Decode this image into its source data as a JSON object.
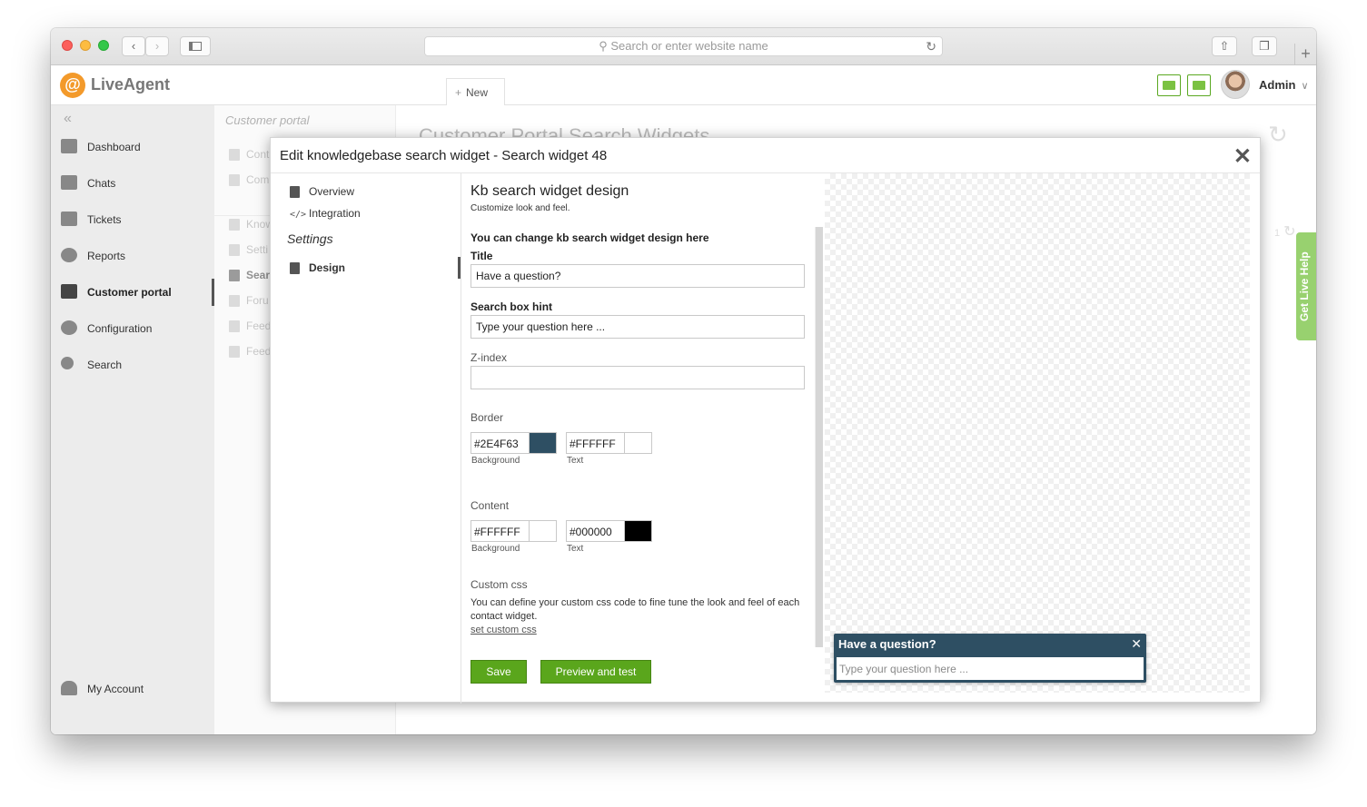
{
  "browser": {
    "url_placeholder": "Search or enter website name",
    "back": "‹",
    "forward": "›",
    "new_tab": "+"
  },
  "app": {
    "logo": "@",
    "name": "LiveAgent",
    "new_label": "New",
    "user": "Admin"
  },
  "sidebar": {
    "items": [
      {
        "label": "Dashboard",
        "icon": "dashboard-icon"
      },
      {
        "label": "Chats",
        "icon": "chat-icon"
      },
      {
        "label": "Tickets",
        "icon": "envelope-icon"
      },
      {
        "label": "Reports",
        "icon": "pie-chart-icon"
      },
      {
        "label": "Customer portal",
        "icon": "portal-icon",
        "active": true
      },
      {
        "label": "Configuration",
        "icon": "gear-icon"
      },
      {
        "label": "Search",
        "icon": "search-icon"
      }
    ],
    "account": "My Account"
  },
  "subbar": {
    "heading": "Customer portal",
    "items": [
      "Cont",
      "Com",
      "Know",
      "Setti",
      "Sear",
      "Foru",
      "Feed",
      "Feed"
    ]
  },
  "page": {
    "title": "Customer Portal Search Widgets",
    "counter": "1"
  },
  "live_help": "Get Live Help",
  "dialog": {
    "title": "Edit knowledgebase search widget - Search widget 48",
    "close": "✕",
    "nav": {
      "overview": "Overview",
      "integration": "Integration",
      "settings": "Settings",
      "design": "Design"
    },
    "form": {
      "heading": "Kb search widget design",
      "subheading": "Customize look and feel.",
      "intro": "You can change kb search widget design here",
      "title_label": "Title",
      "title_value": "Have a question?",
      "hint_label": "Search box hint",
      "hint_value": "Type your question here ...",
      "zindex_label": "Z-index",
      "zindex_value": "",
      "border_label": "Border",
      "border_bg": "#2E4F63",
      "border_text": "#FFFFFF",
      "content_label": "Content",
      "content_bg": "#FFFFFF",
      "content_text": "#000000",
      "background_caption": "Background",
      "text_caption": "Text",
      "custom_label": "Custom css",
      "custom_note": "You can define your custom css code to fine tune the look and feel of each contact widget.",
      "custom_link": "set custom css",
      "save": "Save",
      "preview": "Preview and test"
    },
    "preview_widget": {
      "title": "Have a question?",
      "hint": "Type your question here ...",
      "close": "✕"
    }
  },
  "colors": {
    "accent": "#5aa61c",
    "widget_border": "#2E4F63"
  }
}
